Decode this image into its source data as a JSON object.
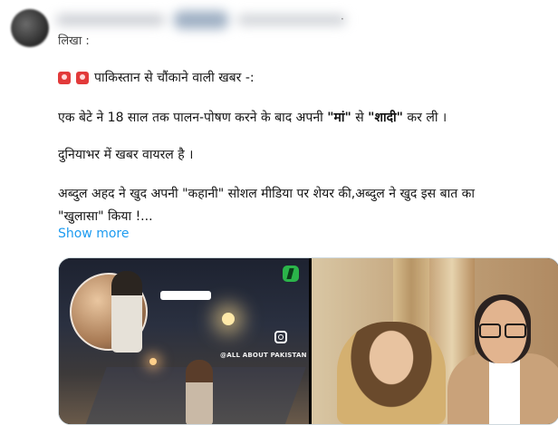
{
  "tweet": {
    "separator": "·",
    "cut_line": "लिखा :",
    "alert_text": "पाकिस्तान से चौंकाने वाली खबर -:",
    "line1_a": "एक बेटे ने 18 साल तक पालन-पोषण करने के बाद अपनी ",
    "line1_b": "\"मां\"",
    "line1_c": " से ",
    "line1_d": "\"शादी\"",
    "line1_e": " कर ली ।",
    "line2": "दुनियाभर में खबर वायरल है ।",
    "line3": "अब्दुल अहद ने खुद अपनी \"कहानी\" सोशल मीडिया पर शेयर की,अब्दुल ने खुद इस बात का",
    "line4": "\"खुलासा\" किया !...",
    "show_more": "Show more"
  },
  "media": {
    "left_watermark": "@ALL ABOUT PAKISTAN",
    "left_icons": [
      "instagram-icon",
      "channel-logo-badge"
    ],
    "accent_link_color": "#1d9bf0"
  }
}
